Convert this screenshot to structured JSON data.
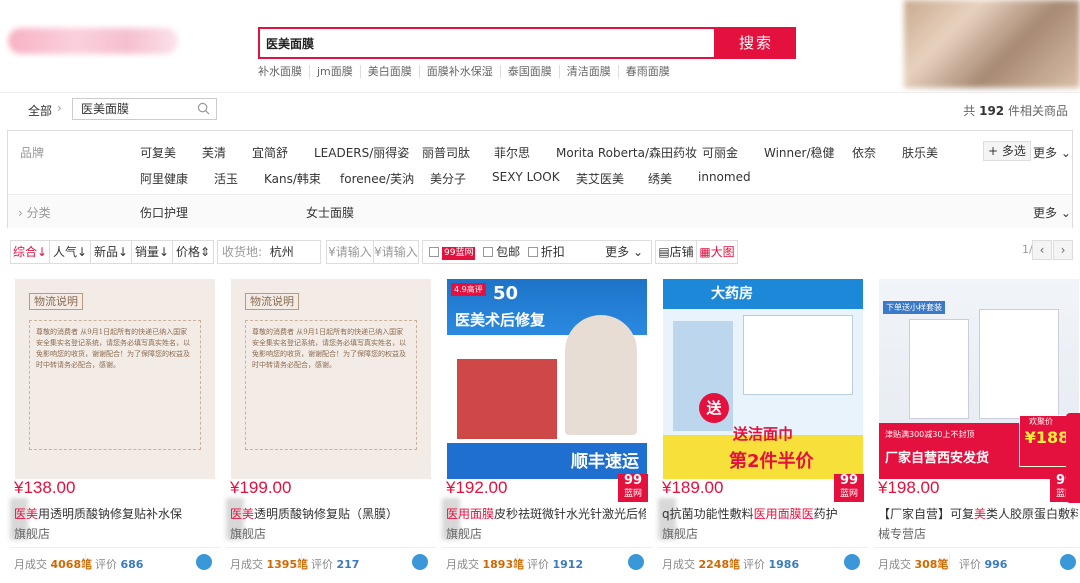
{
  "search": {
    "query": "医美面膜",
    "button_label": "搜索",
    "hot_words": [
      "补水面膜",
      "jm面膜",
      "美白面膜",
      "面膜补水保湿",
      "泰国面膜",
      "清洁面膜",
      "春雨面膜"
    ]
  },
  "breadcrumb": {
    "all_label": "全部",
    "query": "医美面膜",
    "result_prefix": "共",
    "result_count": "192",
    "result_suffix": "件相关商品"
  },
  "filters": {
    "brand_label": "品牌",
    "brands_row1": [
      "可复美",
      "芙清",
      "宜简舒",
      "LEADERS/丽得姿",
      "丽普司肽",
      "菲尔思",
      "Morita Roberta/森田药妆",
      "可丽金",
      "Winner/稳健",
      "依奈",
      "肤乐美"
    ],
    "brands_row2": [
      "阿里健康",
      "活玉",
      "Kans/韩束",
      "forenee/芙汭",
      "美分子",
      "SEXY LOOK",
      "芙艾医美",
      "绣美",
      "innomed"
    ],
    "multi_select": "+ 多选",
    "more": "更多",
    "category_label": "分类",
    "categories": [
      "伤口护理",
      "女士面膜"
    ]
  },
  "sortbar": {
    "comprehensive": "综合",
    "popularity": "人气",
    "new": "新品",
    "sales": "销量",
    "price": "价格",
    "ship_from_label": "收货地:",
    "ship_from_value": "杭州",
    "price_min_placeholder": "¥请输入",
    "price_max_placeholder": "¥请输入",
    "badge_99": "99蓝网",
    "free_shipping": "包邮",
    "discount": "折扣",
    "more": "更多",
    "view_shop": "店铺",
    "view_grid": "大图",
    "page": "1/4"
  },
  "products": [
    {
      "price": "¥138.00",
      "title_pre": "",
      "title_hl": "医美",
      "title_post": "用透明质酸钠修复贴补水保",
      "shop": "旗舰店",
      "sales_label": "月成交",
      "sales": "4068笔",
      "reviews_label": "评价",
      "reviews": "686",
      "badge": false,
      "letter_head": "物流说明",
      "letter_body": "尊敬的消费者 从9月1日起所有的快递已纳入国家安全集实名登记系统，请您务必填写真实姓名，以免影响您的收货，谢谢配合！为了保障您的权益及时中转请务必配合，感谢。"
    },
    {
      "price": "¥199.00",
      "title_pre": "",
      "title_hl": "医美",
      "title_post": "透明质酸钠修复贴（黑膜）",
      "shop": "旗舰店",
      "sales_label": "月成交",
      "sales": "1395笔",
      "reviews_label": "评价",
      "reviews": "217",
      "badge": false,
      "letter_head": "物流说明",
      "letter_body": "尊敬的消费者 从9月1日起所有的快递已纳入国家安全集实名登记系统，请您务必填写真实姓名，以免影响您的收货，谢谢配合！为了保障您的权益及时中转请务必配合，感谢。"
    },
    {
      "price": "¥192.00",
      "title_pre": "医用",
      "title_hl": "面膜",
      "title_post": "皮秒祛斑微针水光针激光后修",
      "shop": "旗舰店",
      "sales_label": "月成交",
      "sales": "1893笔",
      "reviews_label": "评价",
      "reviews": "1912",
      "badge": true,
      "ad_top": "50",
      "ad_title": "医美术后修复",
      "ad_bottom": "顺丰速运",
      "ad_rating": "4.9高评"
    },
    {
      "price": "¥189.00",
      "title_pre": "q抗菌功能性敷料",
      "title_hl": "医用面膜医",
      "title_post": "药护",
      "shop": "旗舰店",
      "sales_label": "月成交",
      "sales": "2248笔",
      "reviews_label": "评价",
      "reviews": "1986",
      "badge": true,
      "ad_top": "大药房",
      "ad_mid": "送洁面巾",
      "ad_bottom": "第2件半价",
      "ad_send": "送"
    },
    {
      "price": "¥198.00",
      "title_pre": "【厂家自营】可复",
      "title_hl": "美",
      "title_post": "类人胶原蛋白敷料",
      "shop": "械专营店",
      "sales_label": "月成交",
      "sales": "308笔",
      "reviews_label": "评价",
      "reviews": "996",
      "badge": true,
      "ad_top": "下单送小样套装",
      "ad_promo": "津贴满300减30上不封顶",
      "ad_bottom": "厂家自营西安发货",
      "ad_price": "¥188",
      "ad_price_tag": "欢聚价"
    }
  ],
  "colors": {
    "accent": "#e4103e",
    "sales": "#d06800",
    "reviews": "#3a7abf"
  }
}
